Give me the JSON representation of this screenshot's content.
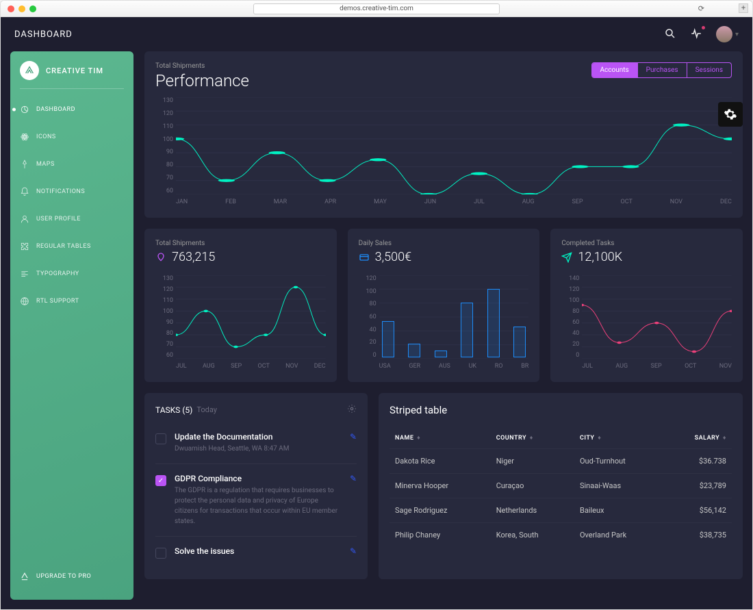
{
  "browser": {
    "url": "demos.creative-tim.com"
  },
  "topbar": {
    "title": "DASHBOARD"
  },
  "brand": {
    "name": "CREATIVE TIM"
  },
  "sidebar": {
    "items": [
      {
        "label": "DASHBOARD",
        "icon": "chart-pie"
      },
      {
        "label": "ICONS",
        "icon": "atom"
      },
      {
        "label": "MAPS",
        "icon": "pin"
      },
      {
        "label": "NOTIFICATIONS",
        "icon": "bell"
      },
      {
        "label": "USER PROFILE",
        "icon": "user"
      },
      {
        "label": "REGULAR TABLES",
        "icon": "puzzle"
      },
      {
        "label": "TYPOGRAPHY",
        "icon": "align"
      },
      {
        "label": "RTL SUPPORT",
        "icon": "globe"
      }
    ],
    "upgrade": "UPGRADE TO PRO"
  },
  "perf": {
    "subtitle": "Total Shipments",
    "title": "Performance",
    "tabs": [
      "Accounts",
      "Purchases",
      "Sessions"
    ]
  },
  "stats": {
    "shipments": {
      "subtitle": "Total Shipments",
      "value": "763,215"
    },
    "sales": {
      "subtitle": "Daily Sales",
      "value": "3,500€"
    },
    "tasks": {
      "subtitle": "Completed Tasks",
      "value": "12,100K"
    }
  },
  "tasks": {
    "heading": "TASKS",
    "count": "(5)",
    "sub": "Today",
    "items": [
      {
        "title": "Update the Documentation",
        "desc": "Dwuamish Head, Seattle, WA 8:47 AM",
        "checked": false
      },
      {
        "title": "GDPR Compliance",
        "desc": "The GDPR is a regulation that requires businesses to protect the personal data and privacy of Europe citizens for transactions that occur within EU member states.",
        "checked": true
      },
      {
        "title": "Solve the issues",
        "desc": "",
        "checked": false
      }
    ]
  },
  "table": {
    "title": "Striped table",
    "headers": [
      "NAME",
      "COUNTRY",
      "CITY",
      "SALARY"
    ],
    "rows": [
      [
        "Dakota Rice",
        "Niger",
        "Oud-Turnhout",
        "$36.738"
      ],
      [
        "Minerva Hooper",
        "Curaçao",
        "Sinaai-Waas",
        "$23,789"
      ],
      [
        "Sage Rodriguez",
        "Netherlands",
        "Baileux",
        "$56,142"
      ],
      [
        "Philip Chaney",
        "Korea, South",
        "Overland Park",
        "$38,735"
      ]
    ]
  },
  "chart_data": [
    {
      "type": "line",
      "title": "Performance",
      "series_name": "Total Shipments",
      "categories": [
        "JAN",
        "FEB",
        "MAR",
        "APR",
        "MAY",
        "JUN",
        "JUL",
        "AUG",
        "SEP",
        "OCT",
        "NOV",
        "DEC"
      ],
      "values": [
        100,
        70,
        90,
        70,
        85,
        60,
        75,
        60,
        80,
        80,
        110,
        100
      ],
      "ylim": [
        60,
        130
      ],
      "yticks": [
        60,
        70,
        80,
        90,
        100,
        110,
        120,
        130
      ],
      "color": "#00f2c3"
    },
    {
      "type": "line",
      "title": "Total Shipments",
      "categories": [
        "JUL",
        "AUG",
        "SEP",
        "OCT",
        "NOV",
        "DEC"
      ],
      "values": [
        80,
        100,
        70,
        80,
        120,
        80
      ],
      "ylim": [
        60,
        130
      ],
      "yticks": [
        60,
        70,
        80,
        90,
        100,
        110,
        120,
        130
      ],
      "color": "#00f2c3"
    },
    {
      "type": "bar",
      "title": "Daily Sales",
      "categories": [
        "USA",
        "GER",
        "AUS",
        "UK",
        "RO",
        "BR"
      ],
      "values": [
        53,
        20,
        10,
        80,
        100,
        45
      ],
      "ylim": [
        0,
        120
      ],
      "yticks": [
        0,
        20,
        40,
        60,
        80,
        100,
        120
      ],
      "color": "#1d8cf8"
    },
    {
      "type": "line",
      "title": "Completed Tasks",
      "categories": [
        "JUL",
        "AUG",
        "SEP",
        "OCT",
        "NOV"
      ],
      "values": [
        90,
        27,
        60,
        12,
        80
      ],
      "ylim": [
        0,
        140
      ],
      "yticks": [
        0,
        20,
        40,
        60,
        80,
        100,
        120,
        140
      ],
      "color": "#ec407a"
    }
  ]
}
